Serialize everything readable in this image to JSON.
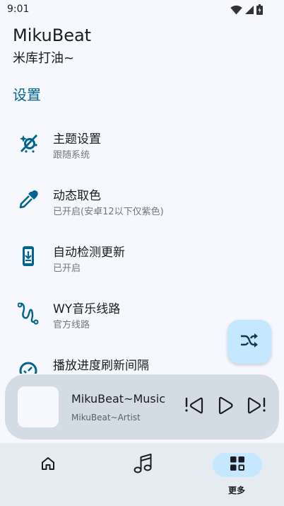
{
  "status_bar": {
    "time": "9:01",
    "icons": [
      "wifi-icon",
      "signal-icon",
      "battery-icon"
    ]
  },
  "header": {
    "title": "MikuBeat",
    "subtitle": "米库打油~"
  },
  "section": {
    "title": "设置"
  },
  "settings": {
    "items": [
      {
        "title": "主题设置",
        "subtitle": "跟随系统",
        "icon": "theme-icon"
      },
      {
        "title": "动态取色",
        "subtitle": "已开启(安卓12以下仅紫色)",
        "icon": "eyedropper-icon"
      },
      {
        "title": "自动检测更新",
        "subtitle": "已开启",
        "icon": "update-icon"
      },
      {
        "title": "WY音乐线路",
        "subtitle": "官方线路",
        "icon": "route-icon"
      },
      {
        "title": "播放进度刷新间隔",
        "subtitle": "",
        "icon": "timer-icon"
      }
    ]
  },
  "fab": {
    "icon": "shuffle-icon"
  },
  "player": {
    "title": "MikuBeat~Music",
    "artist": "MikuBeat~Artist",
    "controls": [
      "previous-icon",
      "play-icon",
      "next-icon"
    ]
  },
  "nav": {
    "items": [
      {
        "label": "",
        "icon": "home-icon",
        "active": false
      },
      {
        "label": "",
        "icon": "music-note-icon",
        "active": false
      },
      {
        "label": "更多",
        "icon": "grid-icon",
        "active": true
      }
    ]
  },
  "colors": {
    "accent": "#00658c",
    "background": "#f6f8fd",
    "fab": "#c3e8ff",
    "player": "#d3dce5",
    "nav": "#e4ecf2"
  }
}
